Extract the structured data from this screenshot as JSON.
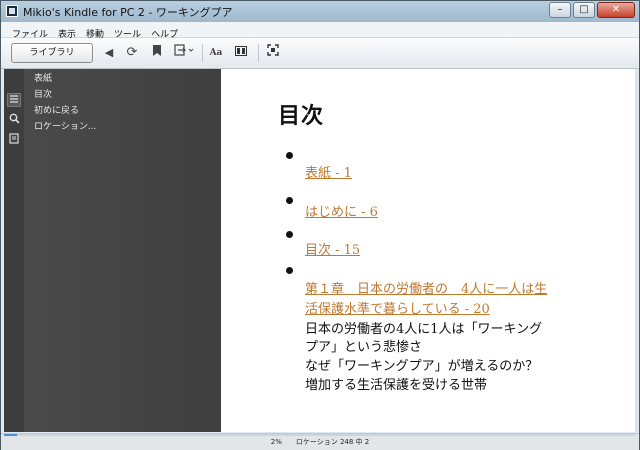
{
  "window": {
    "title": "Mikio's Kindle for PC 2 - ワーキングプア",
    "buttons": {
      "minimize": "–",
      "maximize": "□",
      "close": "✕"
    }
  },
  "menubar": {
    "items": [
      "ファイル",
      "表示",
      "移動",
      "ツール",
      "ヘルプ"
    ]
  },
  "toolbar": {
    "library_label": "ライブラリ",
    "icons": [
      "back-arrow-icon",
      "sync-icon",
      "bookmark-icon",
      "goto-icon",
      "font-size-icon",
      "view-mode-icon",
      "fullscreen-icon"
    ],
    "font_label": "Aa"
  },
  "sidebar": {
    "rail_icons": [
      "toc-list-icon",
      "search-icon",
      "notes-icon"
    ],
    "items": [
      "表紙",
      "目次",
      "初めに戻る",
      "ロケーション..."
    ]
  },
  "content": {
    "heading": "目次",
    "entries": [
      {
        "link": "表紙 - 1"
      },
      {
        "link": "はじめに - 6"
      },
      {
        "link": "目次 - 15"
      },
      {
        "link_line1": "第１章　日本の労働者の　4人に一人は生",
        "link_line2": "活保護水準で暮らしている - 20",
        "text_lines": [
          "日本の労働者の4人に1人は「ワーキング",
          "プア」という悲惨さ",
          "なぜ「ワーキングプア」が増えるのか？",
          " 増加する生活保護を受ける世帯"
        ]
      }
    ]
  },
  "status": {
    "text": "2%　　ロケーション 248 中 2",
    "progress_percent": 2,
    "accent_color": "#4f8fd0",
    "link_color": "#c0792f"
  }
}
